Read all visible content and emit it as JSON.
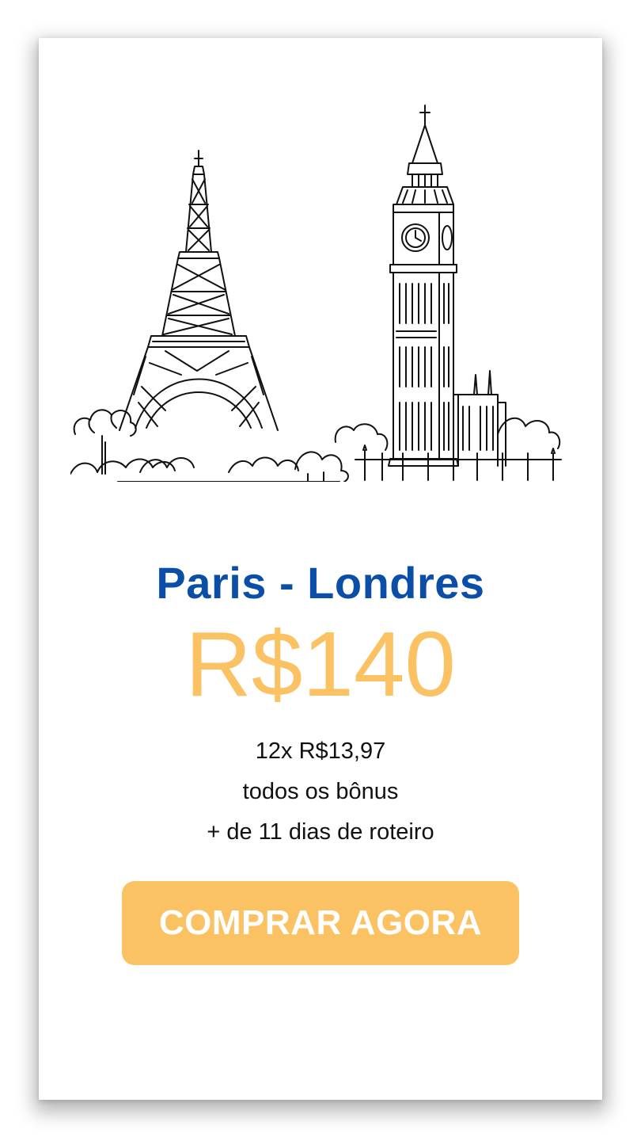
{
  "title": "Paris - Londres",
  "price": "R$140",
  "details": {
    "installments": "12x R$13,97",
    "bonus": "todos os bônus",
    "itinerary": "+ de 11 dias de roteiro"
  },
  "cta": {
    "label": "COMPRAR AGORA"
  },
  "colors": {
    "title": "#0a4ea8",
    "accent": "#fbc264",
    "button_text": "#ffffff",
    "text": "#111111"
  },
  "illustration": {
    "icons": [
      "eiffel-tower-icon",
      "big-ben-icon",
      "trees-icon"
    ]
  }
}
